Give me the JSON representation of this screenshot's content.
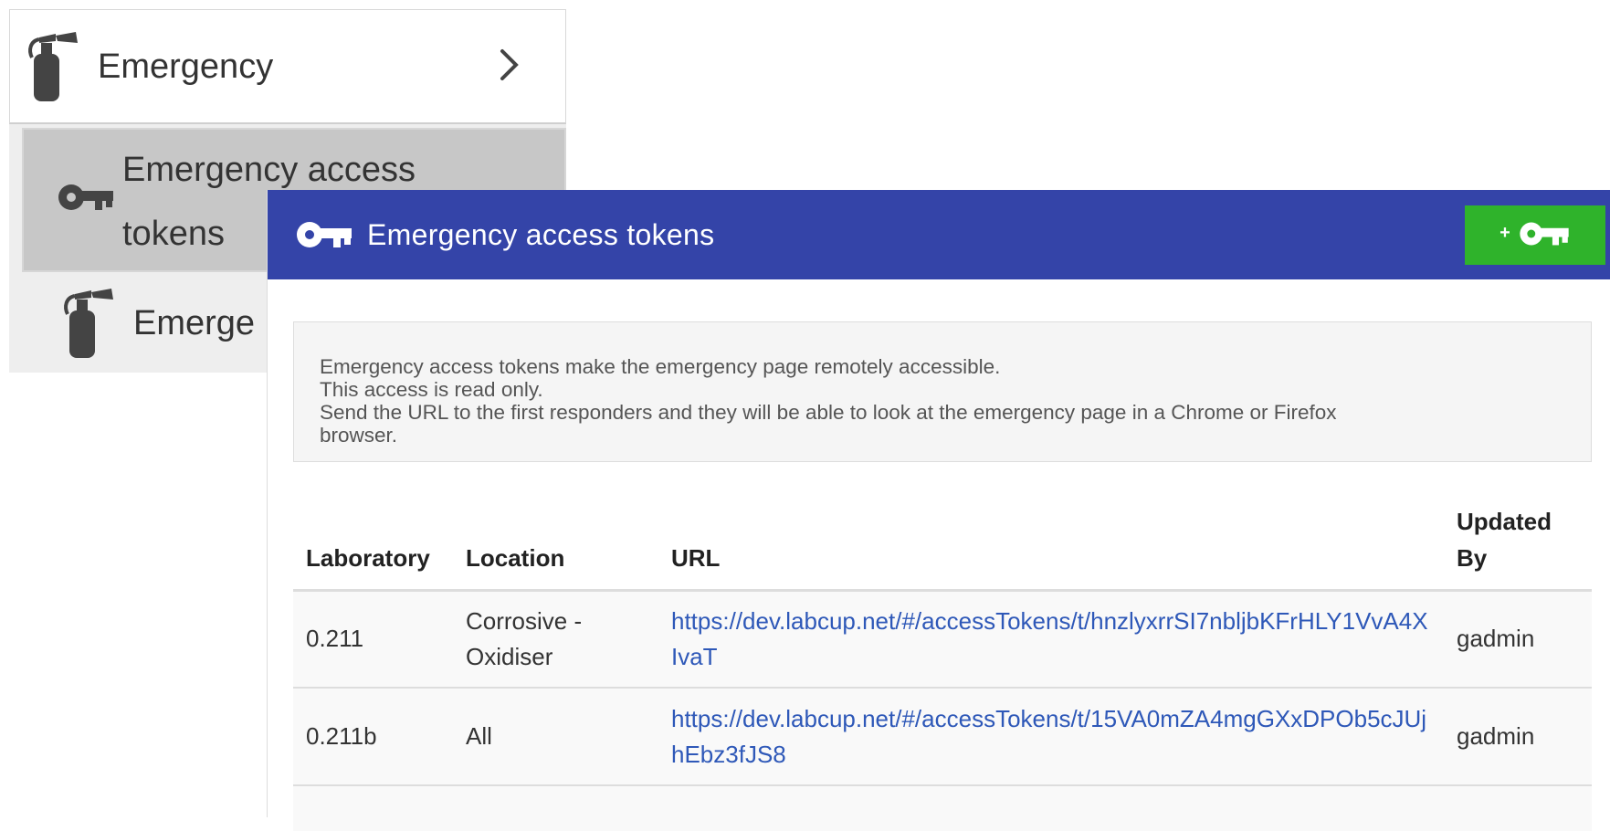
{
  "sidebar": {
    "parent_label": "Emergency",
    "active_item": {
      "label_line1": "Emergency access",
      "label_line2": "tokens"
    },
    "sibling_label": "Emerge"
  },
  "panel": {
    "title": "Emergency access tokens",
    "add_button": {
      "plus": "+",
      "icon": "key-icon"
    },
    "colors": {
      "header": "#3444a8",
      "add_button": "#2fb32b",
      "link": "#2e58b8"
    }
  },
  "info": {
    "lines": [
      "Emergency access tokens make the emergency page remotely accessible.",
      "This access is read only.",
      "Send the URL to the first responders and they will be able to look at the emergency page in a Chrome or Firefox",
      "browser."
    ]
  },
  "table": {
    "headers": {
      "laboratory": "Laboratory",
      "location": "Location",
      "url": "URL",
      "updated_by": "Updated By"
    },
    "rows": [
      {
        "laboratory": "0.211",
        "location": "Corrosive - Oxidiser",
        "url": "https://dev.labcup.net/#/accessTokens/t/hnzlyxrrSI7nbljbKFrHLY1VvA4XIvaT",
        "updated_by": "gadmin"
      },
      {
        "laboratory": "0.211b",
        "location": "All",
        "url": "https://dev.labcup.net/#/accessTokens/t/15VA0mZA4mgGXxDPOb5cJUjhEbz3fJS8",
        "updated_by": "gadmin"
      }
    ]
  }
}
